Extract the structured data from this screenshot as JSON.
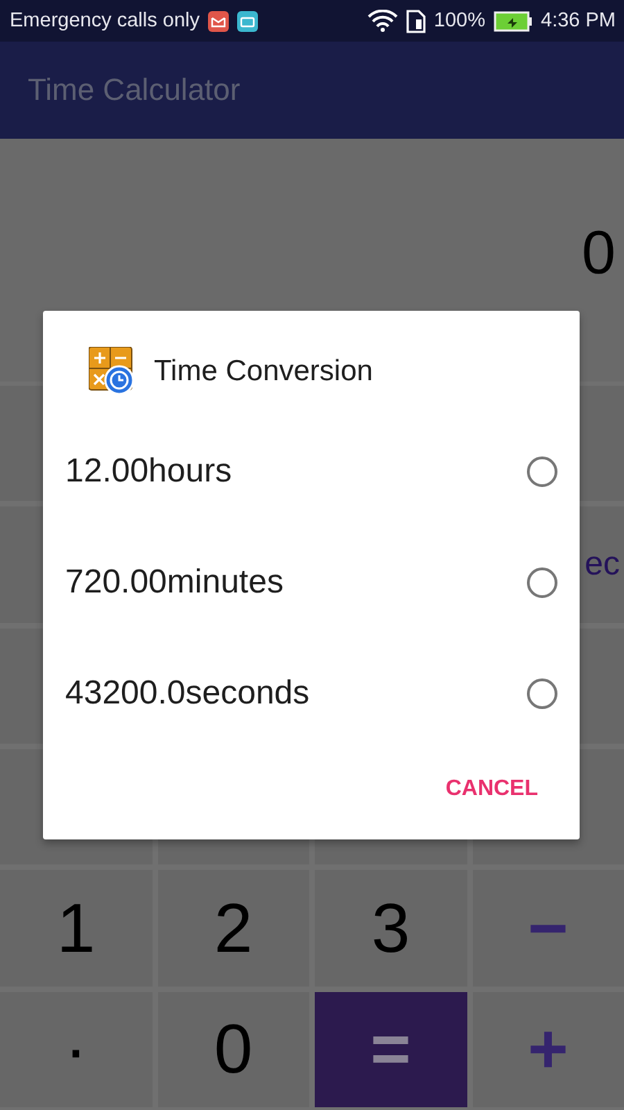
{
  "status_bar": {
    "carrier_text": "Emergency calls only",
    "battery_percent": "100%",
    "time": "4:36 PM"
  },
  "app_bar": {
    "title": "Time Calculator"
  },
  "display": {
    "value": "0"
  },
  "keypad": {
    "rows": [
      {
        "keys": [
          {
            "kind": "covered"
          },
          {
            "kind": "hidden"
          },
          {
            "kind": "hidden"
          },
          {
            "kind": "covered"
          }
        ]
      },
      {
        "keys": [
          {
            "kind": "covered"
          },
          {
            "kind": "hidden"
          },
          {
            "kind": "hidden"
          },
          {
            "kind": "partial",
            "label": "ec"
          }
        ]
      },
      {
        "keys": [
          {
            "kind": "covered"
          },
          {
            "kind": "hidden"
          },
          {
            "kind": "hidden"
          },
          {
            "kind": "covered"
          }
        ]
      },
      {
        "keys": [
          {
            "kind": "covered"
          },
          {
            "kind": "covered"
          },
          {
            "kind": "covered"
          },
          {
            "kind": "covered"
          }
        ]
      },
      {
        "keys": [
          {
            "kind": "digit",
            "label": "1"
          },
          {
            "kind": "digit",
            "label": "2"
          },
          {
            "kind": "digit",
            "label": "3"
          },
          {
            "kind": "operator",
            "label": "−"
          }
        ]
      },
      {
        "keys": [
          {
            "kind": "digit",
            "label": "·"
          },
          {
            "kind": "digit",
            "label": "0"
          },
          {
            "kind": "equals",
            "label": "="
          },
          {
            "kind": "operator",
            "label": "+"
          }
        ]
      }
    ]
  },
  "dialog": {
    "title": "Time Conversion",
    "options": [
      {
        "label": "12.00hours",
        "selected": false
      },
      {
        "label": "720.00minutes",
        "selected": false
      },
      {
        "label": "43200.0seconds",
        "selected": false
      }
    ],
    "buttons": [
      "CANCEL"
    ]
  }
}
